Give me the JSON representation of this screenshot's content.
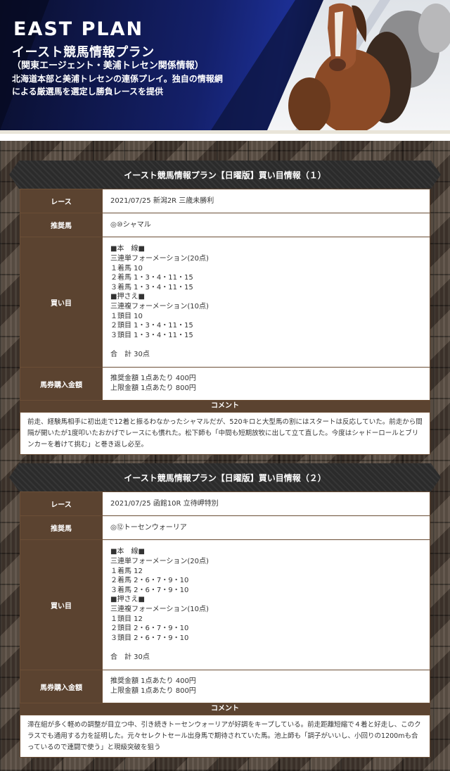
{
  "banner": {
    "brand": "EAST PLAN",
    "title": "イースト競馬情報プラン",
    "subtitle": "（関東エージェント・美浦トレセン関係情報）",
    "description": "北海道本部と美浦トレセンの連係プレイ。独自の情報網による厳選馬を選定し勝負レースを提供",
    "colors": {
      "navy": "#14206a",
      "cream": "#e9e5d9"
    }
  },
  "labels": {
    "race": "レース",
    "horse": "推奨馬",
    "bets": "買い目",
    "amount": "馬券購入金額",
    "comment": "コメント"
  },
  "sections": [
    {
      "header": "イースト競馬情報プラン【日曜版】買い目情報（１）",
      "race": "2021/07/25 新潟2R 三歳未勝利",
      "horse": "◎⑩シャマル",
      "bets": [
        "■本　線■",
        "三連単フォーメーション(20点)",
        "１着馬 10",
        "２着馬 1・3・4・11・15",
        "３着馬 1・3・4・11・15",
        "■押さえ■",
        "三連複フォーメーション(10点)",
        "１頭目 10",
        "２頭目 1・3・4・11・15",
        "３頭目 1・3・4・11・15",
        "",
        "合　計 30点"
      ],
      "amount": [
        "推奨金額 1点あたり 400円",
        "上限金額 1点あたり 800円"
      ],
      "comment": "前走、経験馬相手に初出走で12着と振るわなかったシャマルだが、520キロと大型馬の割にはスタートは反応していた。前走から間隔が開いたが1度叩いたおかげでレースにも慣れた。松下師も「中間も短期放牧に出して立て直した。今度はシャドーロールとブリンカーを着けて挑む」と巻き返し必至。"
    },
    {
      "header": "イースト競馬情報プラン【日曜版】買い目情報（２）",
      "race": "2021/07/25 函館10R 立待岬特別",
      "horse": "◎⑫トーセンウォーリア",
      "bets": [
        "■本　線■",
        "三連単フォーメーション(20点)",
        "１着馬 12",
        "２着馬 2・6・7・9・10",
        "３着馬 2・6・7・9・10",
        "■押さえ■",
        "三連複フォーメーション(10点)",
        "１頭目 12",
        "２頭目 2・6・7・9・10",
        "３頭目 2・6・7・9・10",
        "",
        "合　計 30点"
      ],
      "amount": [
        "推奨金額 1点あたり 400円",
        "上限金額 1点あたり 800円"
      ],
      "comment": "滞在組が多く軽めの調整が目立つ中、引き続きトーセンウォーリアが好調をキープしている。前走距離短縮で４着と好走し、このクラスでも通用する力を証明した。元々セレクトセール出身馬で期待されていた馬。池上師も「調子がいいし、小回りの1200mも合っているので連闘で使う」と現級突破を狙う"
    }
  ]
}
